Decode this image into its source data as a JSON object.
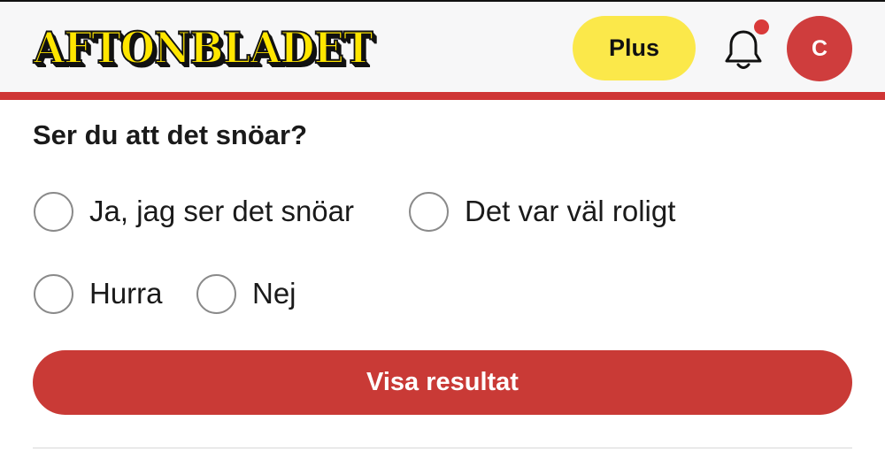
{
  "header": {
    "logo_text": "AFTONBLADET",
    "plus_label": "Plus",
    "avatar_initial": "C"
  },
  "poll": {
    "question": "Ser du att det snöar?",
    "options": [
      {
        "label": "Ja, jag ser det snöar"
      },
      {
        "label": "Det var väl roligt"
      },
      {
        "label": "Hurra"
      },
      {
        "label": "Nej"
      }
    ],
    "submit_label": "Visa resultat"
  },
  "colors": {
    "brand_red": "#cf3535",
    "plus_yellow": "#fbe84a",
    "logo_yellow": "#ffe600"
  }
}
